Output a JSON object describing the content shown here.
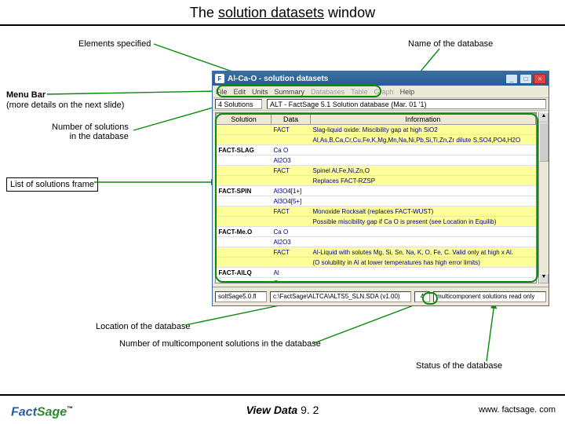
{
  "title": {
    "pre": "The ",
    "mid": "solution datasets",
    "post": " window"
  },
  "annot": {
    "elements": "Elements specified",
    "dbname": "Name of the database",
    "menubar": "Menu Bar",
    "menubar2": "(more details on the next slide)",
    "nsol": "Number of solutions\nin the database",
    "listframe": "List of solutions frame",
    "locdb": "Location of the database",
    "nmulti": "Number of multicomponent solutions in the database",
    "statusdb": "Status of the database"
  },
  "win": {
    "icon": "F",
    "title": "Al-Ca-O  - solution datasets",
    "minimize": "_",
    "maximize": "□",
    "close": "×",
    "menu": [
      "File",
      "Edit",
      "Units",
      "Summary",
      "Databases",
      "Table",
      "Graph",
      "Help"
    ],
    "solcount": "4 Solutions",
    "dbline": "ALT  -  FactSage 5.1 Solution database (Mar. 01 '1)",
    "headers": [
      "Solution",
      "Data",
      "Information"
    ],
    "rows": [
      {
        "band": 1,
        "sol": "",
        "data": "FACT",
        "info": "Slag-liquid oxide: Miscibility gap at high SiO2"
      },
      {
        "band": 1,
        "sol": "",
        "data": "",
        "info": "Al,As,B,Ca,Cr,Cu,Fe,K,Mg,Mn,Na,Ni,Pb,Si,Ti,Zn,Zr dilute S,SO4,PO4,H2O"
      },
      {
        "band": 0,
        "sol": "FACT-SLAG",
        "data": "Ca O",
        "info": ""
      },
      {
        "band": 0,
        "sol": "",
        "data": "Al2O3",
        "info": ""
      },
      {
        "band": 1,
        "sol": "",
        "data": "FACT",
        "info": "Spinel Al,Fe,Ni,Zn,O"
      },
      {
        "band": 1,
        "sol": "",
        "data": "",
        "info": "Replaces FACT-RZSP"
      },
      {
        "band": 0,
        "sol": "FACT-SPIN",
        "data": "Al3O4[1+]",
        "info": ""
      },
      {
        "band": 0,
        "sol": "",
        "data": "Al3O4[5+]",
        "info": ""
      },
      {
        "band": 1,
        "sol": "",
        "data": "FACT",
        "info": "Monoxide Rocksalt (replaces FACT-WUST)"
      },
      {
        "band": 1,
        "sol": "",
        "data": "",
        "info": "Possible miscibility gap if Ca O is present (see Location in Equilib)"
      },
      {
        "band": 0,
        "sol": "FACT-Me.O",
        "data": "Ca O",
        "info": ""
      },
      {
        "band": 0,
        "sol": "",
        "data": "Al2O3",
        "info": ""
      },
      {
        "band": 1,
        "sol": "",
        "data": "FACT",
        "info": "Al-Liquid with solutes Mg, Si, Sn, Na, K, O, Fe, C. Valid only at high x Al."
      },
      {
        "band": 1,
        "sol": "",
        "data": "",
        "info": "(O solubility in Al at lower temperatures has high error limits)"
      },
      {
        "band": 0,
        "sol": "FACT-AlLQ",
        "data": "Al",
        "info": ""
      },
      {
        "band": 0,
        "sol": "",
        "data": "O",
        "info": ""
      }
    ],
    "status": {
      "s1": "soltSage5.0.fl",
      "s2": "c:\\FactSage\\ALTCA\\ALTS5_SLN.SDA (v1.00)",
      "s3": "4",
      "s4": "multicomponent solutions read only"
    }
  },
  "footer": {
    "viewdata": "View Data",
    "section": "  9. 2",
    "url": "www. factsage. com"
  }
}
